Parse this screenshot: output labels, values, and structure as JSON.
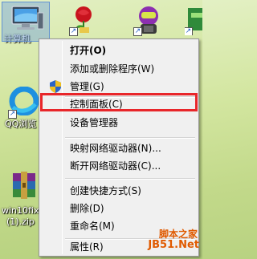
{
  "desktop": {
    "icons": [
      {
        "label": "计算机",
        "icon": "computer-icon"
      },
      {
        "label": "",
        "icon": "rose-shortcut-icon"
      },
      {
        "label": "",
        "icon": "robot-shortcut-icon"
      },
      {
        "label": "",
        "icon": "app-shortcut-icon"
      },
      {
        "label": "QQ浏览",
        "icon": "qq-browser-icon"
      },
      {
        "label": "win10fix",
        "label2": "(1).zip",
        "icon": "winrar-archive-icon"
      }
    ]
  },
  "context_menu": {
    "items": [
      {
        "label": "打开(O)",
        "bold": true
      },
      {
        "label": "添加或删除程序(W)"
      },
      {
        "label": "管理(G)",
        "icon": "uac-shield-icon"
      },
      {
        "label": "控制面板(C)"
      },
      {
        "label": "设备管理器"
      },
      {
        "label": "映射网络驱动器(N)..."
      },
      {
        "label": "断开网络驱动器(C)..."
      },
      {
        "label": "创建快捷方式(S)"
      },
      {
        "label": "删除(D)"
      },
      {
        "label": "重命名(M)"
      },
      {
        "label": "属性(R)"
      }
    ],
    "highlighted_item": "控制面板(C)",
    "highlight_color": "#e8262a"
  },
  "watermark": {
    "text": "脚本之家",
    "url": "JB51.Net"
  }
}
